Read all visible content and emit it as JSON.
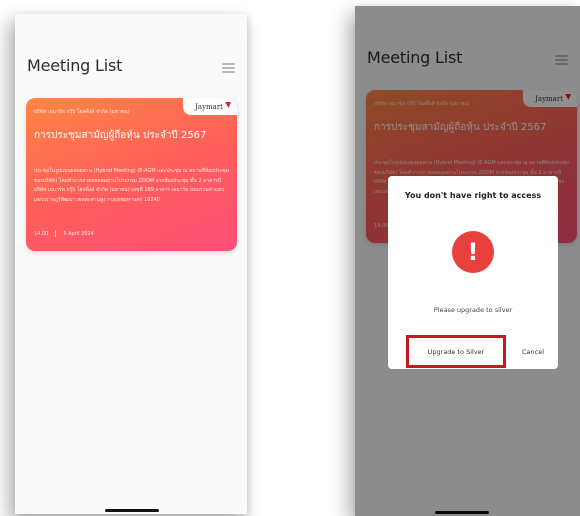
{
  "header": {
    "title": "Meeting List",
    "menu_icon": "hamburger-menu-icon"
  },
  "meeting_card": {
    "company": "บริษัท เจมาร์ท กรุ๊ป โฮลดิ้งส์ จำกัด (มหาชน)",
    "logo_text": "Jaymart",
    "title": "การประชุมสามัญผู้ถือหุ้น ประจำปี 2567",
    "description": "ประชุมในรูปแบบผสมผสาน (Hybrid Meeting) (E-AGM และประชุม ณ สถานที่ห้องประชุมของบริษัท) โดยทำการถ่ายทอดสดผ่านโปรแกรม ZOOM จากห้องประชุม ชั้น 2 อาคารบี บริษัท เจมาร์ท กรุ๊ป โฮลดิ้งส์ จำกัด (มหาชน) เลขที่ 189 อาคาร เจมาร์ท ถนนรามคำแหง แขวงราษฎร์พัฒนา เขตสะพานสูง กรุงเทพมหานคร 10240",
    "time": "14.00",
    "date": "5 April 2024",
    "colors": {
      "gradient_start": "#ff8744",
      "gradient_end": "#ff4e7a"
    }
  },
  "dialog": {
    "title": "You don't have right to access",
    "icon": "exclamation-alert-icon",
    "icon_color": "#e8403c",
    "message": "Please upgrade to silver",
    "upgrade_label": "Upgrade to Silver",
    "cancel_label": "Cancel",
    "highlight_color": "#c21a1f"
  }
}
